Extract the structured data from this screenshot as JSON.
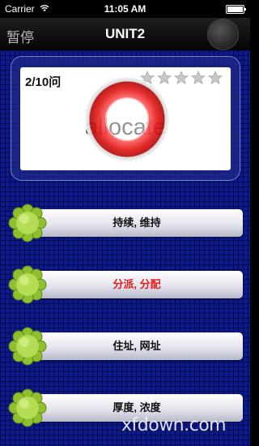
{
  "status_bar": {
    "carrier": "Carrier",
    "time": "11:05 AM"
  },
  "nav_bar": {
    "pause_label": "暂停",
    "title": "UNIT2"
  },
  "card": {
    "progress": "2/10问",
    "word": "allocate",
    "stars_total": 5
  },
  "options": [
    {
      "label": "持续, 维持"
    },
    {
      "label": "分派, 分配",
      "color": "#e02020"
    },
    {
      "label": "住址, 网址"
    },
    {
      "label": "厚度, 浓度"
    }
  ],
  "colors": {
    "background": "#0d1a8a",
    "ring": "#e21c1c",
    "flower": "#9ccc3a"
  },
  "watermark": "xfdown.com"
}
